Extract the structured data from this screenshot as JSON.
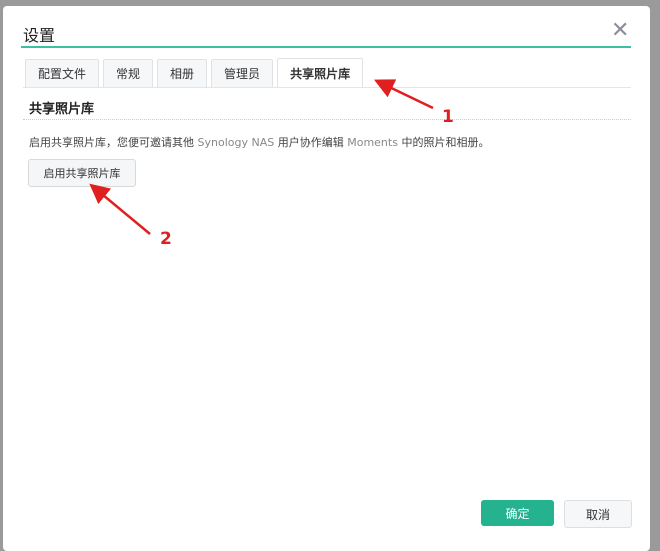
{
  "dialog": {
    "title": "设置",
    "close_icon": "close-icon"
  },
  "tabs": [
    {
      "label": "配置文件"
    },
    {
      "label": "常规"
    },
    {
      "label": "相册"
    },
    {
      "label": "管理员"
    },
    {
      "label": "共享照片库",
      "active": true
    }
  ],
  "section": {
    "title": "共享照片库",
    "description_parts": [
      "启用共享照片库，您便可邀请其他 ",
      "Synology NAS",
      " 用户协作编辑 ",
      "Moments",
      " 中的照片和相册。"
    ],
    "enable_button": "启用共享照片库"
  },
  "footer": {
    "ok": "确定",
    "cancel": "取消"
  },
  "annotations": {
    "label1": "1",
    "label2": "2",
    "color": "#e02020"
  }
}
